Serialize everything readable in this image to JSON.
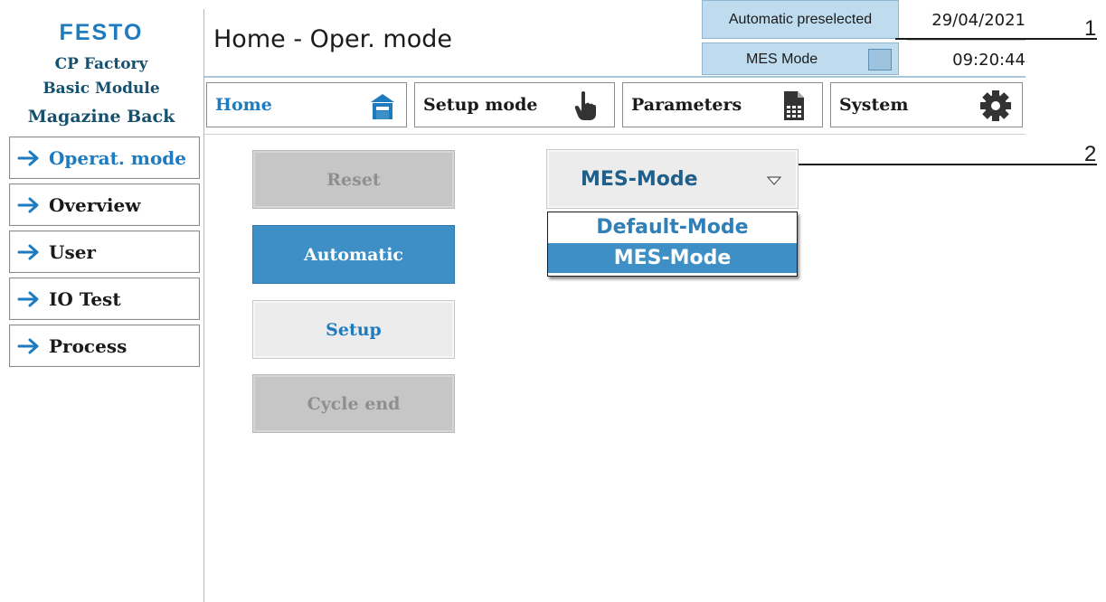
{
  "brand": {
    "logo": "FESTO",
    "line1": "CP Factory",
    "line2": "Basic Module",
    "line3": "Magazine Back"
  },
  "header": {
    "title": "Home - Oper. mode",
    "status_preselected": "Automatic preselected",
    "status_mes_label": "MES Mode",
    "date": "29/04/2021",
    "time": "09:20:44"
  },
  "callouts": [
    "1",
    "2"
  ],
  "nav": {
    "items": [
      {
        "label": "Home",
        "icon": "home-icon",
        "active": true
      },
      {
        "label": "Setup mode",
        "icon": "hand-pointer-icon"
      },
      {
        "label": "Parameters",
        "icon": "document-table-icon"
      },
      {
        "label": "System",
        "icon": "gear-icon"
      }
    ]
  },
  "sidebar": {
    "items": [
      {
        "label": "Operat. mode",
        "active": true
      },
      {
        "label": "Overview"
      },
      {
        "label": "User"
      },
      {
        "label": "IO Test"
      },
      {
        "label": "Process"
      }
    ]
  },
  "modes": {
    "reset": "Reset",
    "automatic": "Automatic",
    "setup": "Setup",
    "cycle_end": "Cycle end"
  },
  "dropdown": {
    "selected": "MES-Mode",
    "options": [
      "Default-Mode",
      "MES-Mode"
    ]
  },
  "colors": {
    "accent": "#1f7bbf",
    "selected_fill": "#3d8fc6",
    "status_fill": "#bfdcef",
    "disabled_fill": "#c6c6c6"
  }
}
